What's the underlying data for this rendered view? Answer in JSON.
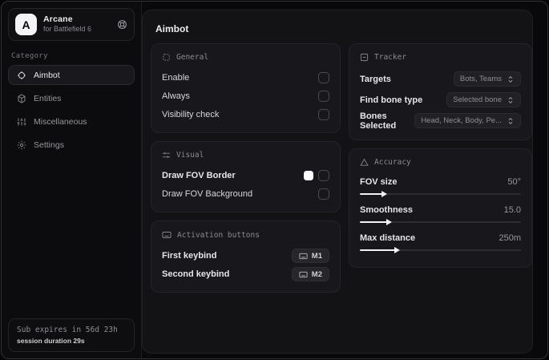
{
  "app": {
    "logo_letter": "A",
    "name": "Arcane",
    "subtitle": "for Battlefield 6"
  },
  "sidebar": {
    "category_label": "Category",
    "items": [
      {
        "label": "Aimbot",
        "icon": "crosshair-icon",
        "active": true
      },
      {
        "label": "Entities",
        "icon": "entities-icon",
        "active": false
      },
      {
        "label": "Miscellaneous",
        "icon": "sliders-icon",
        "active": false
      },
      {
        "label": "Settings",
        "icon": "gear-icon",
        "active": false
      }
    ],
    "sub_expires": "Sub expires in 56d 23h",
    "session_duration": "session duration 29s"
  },
  "header": {
    "title": "Aimbot"
  },
  "cards": {
    "general": {
      "title": "General",
      "rows": [
        {
          "label": "Enable",
          "checked": false
        },
        {
          "label": "Always",
          "checked": false
        },
        {
          "label": "Visibility check",
          "checked": false
        }
      ]
    },
    "visual": {
      "title": "Visual",
      "rows": [
        {
          "label": "Draw FOV Border",
          "has_swatch": true,
          "swatch_color": "#ffffff",
          "checked": false
        },
        {
          "label": "Draw FOV Background",
          "has_swatch": false,
          "checked": false
        }
      ]
    },
    "activation": {
      "title": "Activation buttons",
      "rows": [
        {
          "label": "First keybind",
          "key": "M1"
        },
        {
          "label": "Second keybind",
          "key": "M2"
        }
      ]
    },
    "tracker": {
      "title": "Tracker",
      "rows": [
        {
          "label": "Targets",
          "value": "Bots, Teams"
        },
        {
          "label": "Find bone type",
          "value": "Selected bone"
        },
        {
          "label": "Bones Selected",
          "value": "Head, Neck, Body, Pe..."
        }
      ]
    },
    "accuracy": {
      "title": "Accuracy",
      "sliders": [
        {
          "label": "FOV size",
          "value": "50°",
          "fill_percent": 14
        },
        {
          "label": "Smoothness",
          "value": "15.0",
          "fill_percent": 17
        },
        {
          "label": "Max distance",
          "value": "250m",
          "fill_percent": 22
        }
      ]
    }
  },
  "colors": {
    "accent": "#f2f2f4",
    "card_bg": "#18181c",
    "panel_bg": "#131316",
    "sidebar_bg": "#0c0c0e"
  }
}
